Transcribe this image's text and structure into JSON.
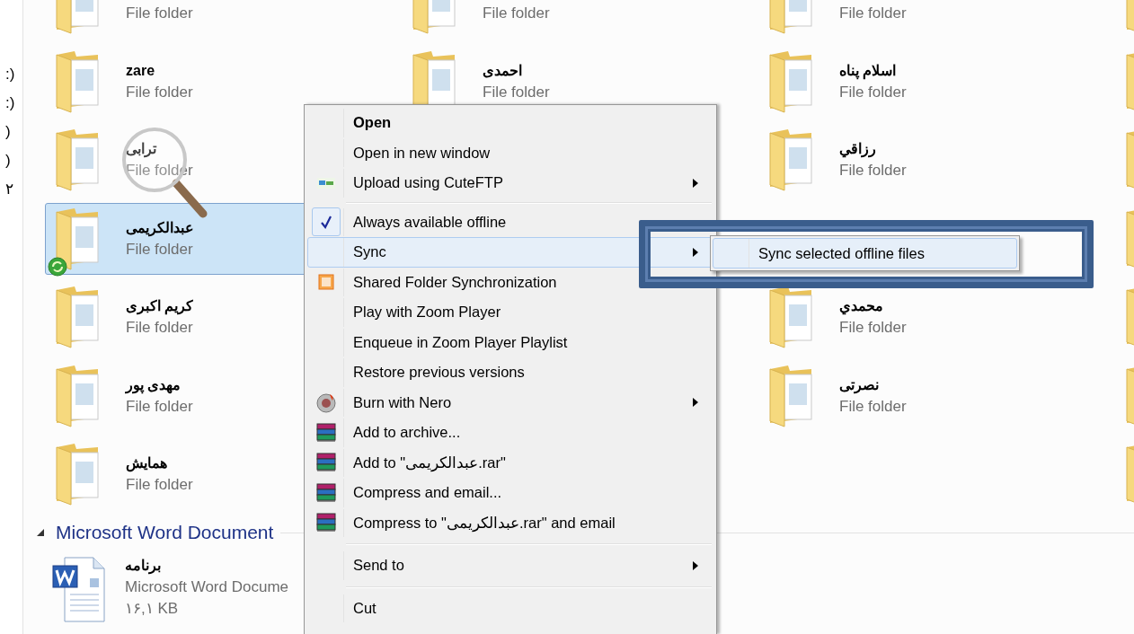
{
  "nav_fragments": [
    ":)",
    ":)",
    ")",
    ")",
    "۲"
  ],
  "folder_rows": [
    {
      "column_1": {
        "type": "File folder",
        "selected": false,
        "sync_overlay": false
      },
      "column_2": {
        "type": "File folder",
        "selected": false,
        "sync_overlay": false
      },
      "column_3": {
        "type": "File folder",
        "selected": false,
        "sync_overlay": false
      },
      "column_4": {
        "selected": false,
        "sync_overlay": false
      }
    },
    {
      "column_1": {
        "name": "zare",
        "type": "File folder",
        "selected": false,
        "sync_overlay": false
      },
      "column_2": {
        "name": "احمدی",
        "type": "File folder",
        "selected": false,
        "sync_overlay": false
      },
      "column_3": {
        "name": "اسلام پناه",
        "type": "File folder",
        "selected": false,
        "sync_overlay": false
      },
      "column_4": {
        "selected": false,
        "sync_overlay": false
      }
    },
    {
      "column_1": {
        "name": "ترابی",
        "type": "File folder",
        "selected": false,
        "sync_overlay": false
      },
      "column_3": {
        "name": "رزاقي",
        "type": "File folder",
        "selected": false,
        "sync_overlay": false
      },
      "column_4": {
        "selected": false,
        "sync_overlay": false
      }
    },
    {
      "column_1": {
        "name": "عبدالکریمی",
        "type": "File folder",
        "selected": true,
        "sync_overlay": true
      },
      "column_4": {
        "selected": false,
        "sync_overlay": false
      }
    },
    {
      "column_1": {
        "name": "کریم اکبری",
        "type": "File folder",
        "selected": false,
        "sync_overlay": false
      },
      "column_3": {
        "name": "محمدي",
        "type": "File folder",
        "selected": false,
        "sync_overlay": false
      },
      "column_4": {
        "selected": false,
        "sync_overlay": false
      }
    },
    {
      "column_1": {
        "name": "مهدی پور",
        "type": "File folder",
        "selected": false,
        "sync_overlay": false
      },
      "column_3": {
        "name": "نصرتی",
        "type": "File folder",
        "selected": false,
        "sync_overlay": false
      },
      "column_4": {
        "selected": false,
        "sync_overlay": false
      }
    },
    {
      "column_1": {
        "name": "همایش",
        "type": "File folder",
        "selected": false,
        "sync_overlay": false
      },
      "column_4": {
        "selected": false,
        "sync_overlay": false
      }
    }
  ],
  "group": {
    "title": "Microsoft Word Document",
    "expanded": true,
    "items": [
      {
        "name": "برنامه",
        "type": "Microsoft Word Docume",
        "size": "۱۶,۱ KB"
      }
    ]
  },
  "context_menu": [
    {
      "kind": "plain",
      "label": "Open",
      "bold": true,
      "submenu": false,
      "checked": false,
      "selected": false
    },
    {
      "kind": "plain",
      "label": "Open in new window",
      "bold": false,
      "submenu": false,
      "checked": false,
      "selected": false
    },
    {
      "kind": "ftp",
      "label": "Upload using CuteFTP",
      "bold": false,
      "submenu": true,
      "checked": false,
      "selected": false
    },
    {
      "kind": "separator"
    },
    {
      "kind": "plain",
      "label": "Always available offline",
      "bold": false,
      "submenu": false,
      "checked": true,
      "selected": false
    },
    {
      "kind": "plain",
      "label": "Sync",
      "bold": false,
      "submenu": true,
      "checked": false,
      "selected": true
    },
    {
      "kind": "sharedsync",
      "label": "Shared Folder Synchronization",
      "bold": false,
      "submenu": false,
      "checked": false,
      "selected": false
    },
    {
      "kind": "plain",
      "label": "Play with Zoom Player",
      "bold": false,
      "submenu": false,
      "checked": false,
      "selected": false
    },
    {
      "kind": "plain",
      "label": "Enqueue in Zoom Player Playlist",
      "bold": false,
      "submenu": false,
      "checked": false,
      "selected": false
    },
    {
      "kind": "plain",
      "label": "Restore previous versions",
      "bold": false,
      "submenu": false,
      "checked": false,
      "selected": false
    },
    {
      "kind": "nero",
      "label": "Burn with Nero",
      "bold": false,
      "submenu": true,
      "checked": false,
      "selected": false
    },
    {
      "kind": "winrar",
      "label": "Add to archive...",
      "bold": false,
      "submenu": false,
      "checked": false,
      "selected": false
    },
    {
      "kind": "winrar",
      "label": "Add to \"عبدالکریمی.rar\"",
      "bold": false,
      "submenu": false,
      "checked": false,
      "selected": false
    },
    {
      "kind": "winrar",
      "label": "Compress and email...",
      "bold": false,
      "submenu": false,
      "checked": false,
      "selected": false
    },
    {
      "kind": "winrar",
      "label": "Compress to \"عبدالکریمی.rar\" and email",
      "bold": false,
      "submenu": false,
      "checked": false,
      "selected": false
    },
    {
      "kind": "separator"
    },
    {
      "kind": "plain",
      "label": "Send to",
      "bold": false,
      "submenu": true,
      "checked": false,
      "selected": false
    },
    {
      "kind": "separator"
    },
    {
      "kind": "plain",
      "label": "Cut",
      "bold": false,
      "submenu": false,
      "checked": false,
      "selected": false
    }
  ],
  "sync_submenu": [
    {
      "label": "Sync selected offline files",
      "selected": true
    }
  ]
}
